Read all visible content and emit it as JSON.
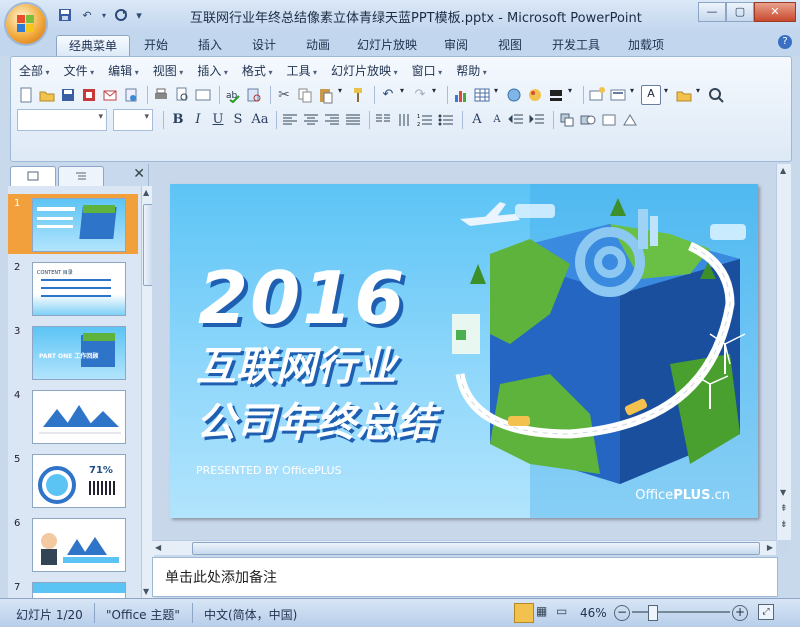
{
  "window": {
    "title": "互联网行业年终总结像素立体青绿天蓝PPT模板.pptx - Microsoft PowerPoint",
    "controls": {
      "minimize": "—",
      "maximize": "▢",
      "close": "✕"
    }
  },
  "qat_icons": [
    "save-icon",
    "undo-icon",
    "redo-icon",
    "customize-icon"
  ],
  "tabs": [
    "经典菜单",
    "开始",
    "插入",
    "设计",
    "动画",
    "幻灯片放映",
    "审阅",
    "视图",
    "开发工具",
    "加载项"
  ],
  "active_tab": "经典菜单",
  "classic_menu": [
    "全部",
    "文件",
    "编辑",
    "视图",
    "插入",
    "格式",
    "工具",
    "幻灯片放映",
    "窗口",
    "帮助"
  ],
  "format_buttons": {
    "bold": "B",
    "italic": "I",
    "underline": "U",
    "shadow": "S",
    "case": "Aa",
    "textbox": "A",
    "font_grow": "A",
    "font_shrink": "A"
  },
  "left_panel": {
    "slide_numbers": [
      "1",
      "2",
      "3",
      "4",
      "5",
      "6",
      "7"
    ],
    "thumb2_text": "CONTENT 目录",
    "thumb3_text": "PART ONE 工作回顾",
    "thumb5_text": "71%"
  },
  "slide": {
    "year": "2016",
    "line1": "互联网行业",
    "line2": "公司年终总结",
    "presented": "PRESENTED BY OfficePLUS",
    "brand_prefix": "Office",
    "brand_suffix": "PLUS",
    "brand_tld": ".cn"
  },
  "notes_placeholder": "单击此处添加备注",
  "status": {
    "slide_info": "幻灯片 1/20",
    "theme": "\"Office 主题\"",
    "language": "中文(简体，中国)",
    "zoom": "46%",
    "zoom_minus": "−",
    "zoom_plus": "+"
  },
  "colors": {
    "accent": "#f2a93a",
    "slide_bg": "#5cc4f5",
    "selected_thumb": "#f2a03c"
  }
}
